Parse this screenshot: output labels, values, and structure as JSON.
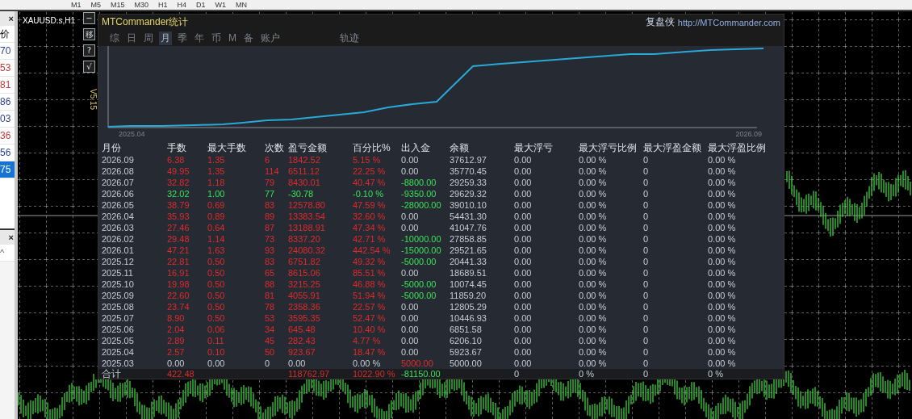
{
  "toolbar": {
    "timeframes": [
      "M1",
      "M5",
      "M15",
      "M30",
      "H1",
      "H4",
      "D1",
      "W1",
      "MN"
    ]
  },
  "quotes": {
    "close": "×",
    "header": "价",
    "items": [
      {
        "text": "70",
        "color": "#2b3f8f",
        "selected": false
      },
      {
        "text": "53",
        "color": "#c03a3a",
        "selected": false
      },
      {
        "text": "81",
        "color": "#c03a3a",
        "selected": false
      },
      {
        "text": "86",
        "color": "#2b3f8f",
        "selected": false
      },
      {
        "text": "03",
        "color": "#2b3f8f",
        "selected": false
      },
      {
        "text": "36",
        "color": "#c03a3a",
        "selected": false
      },
      {
        "text": "56",
        "color": "#2b3f8f",
        "selected": false
      },
      {
        "text": "75",
        "color": "#ffffff",
        "selected": true
      }
    ],
    "lower_close": "×",
    "lower_collapse": "^"
  },
  "chart": {
    "symbol": "XAUUSD.s,H1",
    "version": "V5.15",
    "side_buttons": [
      "−",
      "移",
      "?",
      "√"
    ]
  },
  "panel": {
    "title": "MTCommander统计",
    "brand": "复盘侠",
    "url": "http://MTCommander.com",
    "tabs": [
      {
        "label": "综",
        "selected": false
      },
      {
        "label": "日",
        "selected": false
      },
      {
        "label": "周",
        "selected": false
      },
      {
        "label": "月",
        "selected": true
      },
      {
        "label": "季",
        "selected": false
      },
      {
        "label": "年",
        "selected": false
      },
      {
        "label": "币",
        "selected": false
      },
      {
        "label": "M",
        "selected": false
      },
      {
        "label": "备",
        "selected": false
      },
      {
        "label": "账户",
        "selected": false
      }
    ],
    "trajectory": "轨迹",
    "equity": {
      "start_label": "2025.04",
      "end_label": "2026.09"
    },
    "columns": [
      "月份",
      "手数",
      "最大手数",
      "次数",
      "盈亏金额",
      "百分比%",
      "出入金",
      "余额",
      "最大浮亏",
      "最大浮亏比例",
      "最大浮盈金额",
      "最大浮盈比例"
    ],
    "rows": [
      {
        "kind": "profit",
        "month": "2026.09",
        "figures": [
          "6.38",
          "1.35",
          "6",
          "1842.52",
          "5.15 %"
        ],
        "flow": {
          "text": "0.00",
          "kind": "none"
        },
        "rest": [
          "37612.97",
          "0.00",
          "0.00 %",
          "0",
          "0.00 %"
        ]
      },
      {
        "kind": "profit",
        "month": "2026.08",
        "figures": [
          "49.95",
          "1.35",
          "114",
          "6511.12",
          "22.25 %"
        ],
        "flow": {
          "text": "0.00",
          "kind": "none"
        },
        "rest": [
          "35770.45",
          "0.00",
          "0.00 %",
          "0",
          "0.00 %"
        ]
      },
      {
        "kind": "profit",
        "month": "2026.07",
        "figures": [
          "32.82",
          "1.18",
          "79",
          "8430.01",
          "40.47 %"
        ],
        "flow": {
          "text": "-8800.00",
          "kind": "withdrawal"
        },
        "rest": [
          "29259.33",
          "0.00",
          "0.00 %",
          "0",
          "0.00 %"
        ]
      },
      {
        "kind": "loss",
        "month": "2026.06",
        "figures": [
          "32.02",
          "1.00",
          "77",
          "-30.78",
          "-0.10 %"
        ],
        "flow": {
          "text": "-9350.00",
          "kind": "withdrawal"
        },
        "rest": [
          "29629.32",
          "0.00",
          "0.00 %",
          "0",
          "0.00 %"
        ]
      },
      {
        "kind": "profit",
        "month": "2026.05",
        "figures": [
          "38.79",
          "0.69",
          "83",
          "12578.80",
          "47.59 %"
        ],
        "flow": {
          "text": "-28000.00",
          "kind": "withdrawal"
        },
        "rest": [
          "39010.10",
          "0.00",
          "0.00 %",
          "0",
          "0.00 %"
        ]
      },
      {
        "kind": "profit",
        "month": "2026.04",
        "figures": [
          "35.93",
          "0.89",
          "89",
          "13383.54",
          "32.60 %"
        ],
        "flow": {
          "text": "0.00",
          "kind": "none"
        },
        "rest": [
          "54431.30",
          "0.00",
          "0.00 %",
          "0",
          "0.00 %"
        ]
      },
      {
        "kind": "profit",
        "month": "2026.03",
        "figures": [
          "27.46",
          "0.64",
          "87",
          "13188.91",
          "47.34 %"
        ],
        "flow": {
          "text": "0.00",
          "kind": "none"
        },
        "rest": [
          "41047.76",
          "0.00",
          "0.00 %",
          "0",
          "0.00 %"
        ]
      },
      {
        "kind": "profit",
        "month": "2026.02",
        "figures": [
          "29.48",
          "1.14",
          "73",
          "8337.20",
          "42.71 %"
        ],
        "flow": {
          "text": "-10000.00",
          "kind": "withdrawal"
        },
        "rest": [
          "27858.85",
          "0.00",
          "0.00 %",
          "0",
          "0.00 %"
        ]
      },
      {
        "kind": "profit",
        "month": "2026.01",
        "figures": [
          "47.21",
          "1.63",
          "93",
          "24080.32",
          "442.54 %"
        ],
        "flow": {
          "text": "-15000.00",
          "kind": "withdrawal"
        },
        "rest": [
          "29521.65",
          "0.00",
          "0.00 %",
          "0",
          "0.00 %"
        ]
      },
      {
        "kind": "profit",
        "month": "2025.12",
        "figures": [
          "22.81",
          "0.50",
          "83",
          "6751.82",
          "49.32 %"
        ],
        "flow": {
          "text": "-5000.00",
          "kind": "withdrawal"
        },
        "rest": [
          "20441.33",
          "0.00",
          "0.00 %",
          "0",
          "0.00 %"
        ]
      },
      {
        "kind": "profit",
        "month": "2025.11",
        "figures": [
          "16.91",
          "0.50",
          "65",
          "8615.06",
          "85.51 %"
        ],
        "flow": {
          "text": "0.00",
          "kind": "none"
        },
        "rest": [
          "18689.51",
          "0.00",
          "0.00 %",
          "0",
          "0.00 %"
        ]
      },
      {
        "kind": "profit",
        "month": "2025.10",
        "figures": [
          "19.98",
          "0.50",
          "88",
          "3215.25",
          "46.88 %"
        ],
        "flow": {
          "text": "-5000.00",
          "kind": "withdrawal"
        },
        "rest": [
          "10074.45",
          "0.00",
          "0.00 %",
          "0",
          "0.00 %"
        ]
      },
      {
        "kind": "profit",
        "month": "2025.09",
        "figures": [
          "22.60",
          "0.50",
          "81",
          "4055.91",
          "51.94 %"
        ],
        "flow": {
          "text": "-5000.00",
          "kind": "withdrawal"
        },
        "rest": [
          "11859.20",
          "0.00",
          "0.00 %",
          "0",
          "0.00 %"
        ]
      },
      {
        "kind": "profit",
        "month": "2025.08",
        "figures": [
          "23.74",
          "0.50",
          "78",
          "2358.36",
          "22.57 %"
        ],
        "flow": {
          "text": "0.00",
          "kind": "none"
        },
        "rest": [
          "12805.29",
          "0.00",
          "0.00 %",
          "0",
          "0.00 %"
        ]
      },
      {
        "kind": "profit",
        "month": "2025.07",
        "figures": [
          "8.90",
          "0.50",
          "53",
          "3595.35",
          "52.47 %"
        ],
        "flow": {
          "text": "0.00",
          "kind": "none"
        },
        "rest": [
          "10446.93",
          "0.00",
          "0.00 %",
          "0",
          "0.00 %"
        ]
      },
      {
        "kind": "profit",
        "month": "2025.06",
        "figures": [
          "2.04",
          "0.06",
          "34",
          "645.48",
          "10.40 %"
        ],
        "flow": {
          "text": "0.00",
          "kind": "none"
        },
        "rest": [
          "6851.58",
          "0.00",
          "0.00 %",
          "0",
          "0.00 %"
        ]
      },
      {
        "kind": "profit",
        "month": "2025.05",
        "figures": [
          "2.89",
          "0.11",
          "45",
          "282.43",
          "4.77 %"
        ],
        "flow": {
          "text": "0.00",
          "kind": "none"
        },
        "rest": [
          "6206.10",
          "0.00",
          "0.00 %",
          "0",
          "0.00 %"
        ]
      },
      {
        "kind": "profit",
        "month": "2025.04",
        "figures": [
          "2.57",
          "0.10",
          "50",
          "923.67",
          "18.47 %"
        ],
        "flow": {
          "text": "0.00",
          "kind": "none"
        },
        "rest": [
          "5923.67",
          "0.00",
          "0.00 %",
          "0",
          "0.00 %"
        ]
      },
      {
        "kind": "flat",
        "month": "2025.03",
        "figures": [
          "0.00",
          "0.00",
          "0",
          "0.00",
          "0.00 %"
        ],
        "flow": {
          "text": "5000.00",
          "kind": "deposit"
        },
        "rest": [
          "5000.00",
          "0.00",
          "0.00 %",
          "0",
          "0.00 %"
        ]
      }
    ],
    "total": {
      "kind": "profit",
      "label": "合计",
      "lots": "422.48",
      "pnl": "118762.97",
      "pct": "1022.90 %",
      "flow": {
        "text": "-81150.00",
        "kind": "withdrawal"
      },
      "max_float_loss": "0",
      "max_float_loss_pct": "0 %",
      "max_float_profit": "0",
      "max_float_profit_pct": "0 %"
    }
  }
}
